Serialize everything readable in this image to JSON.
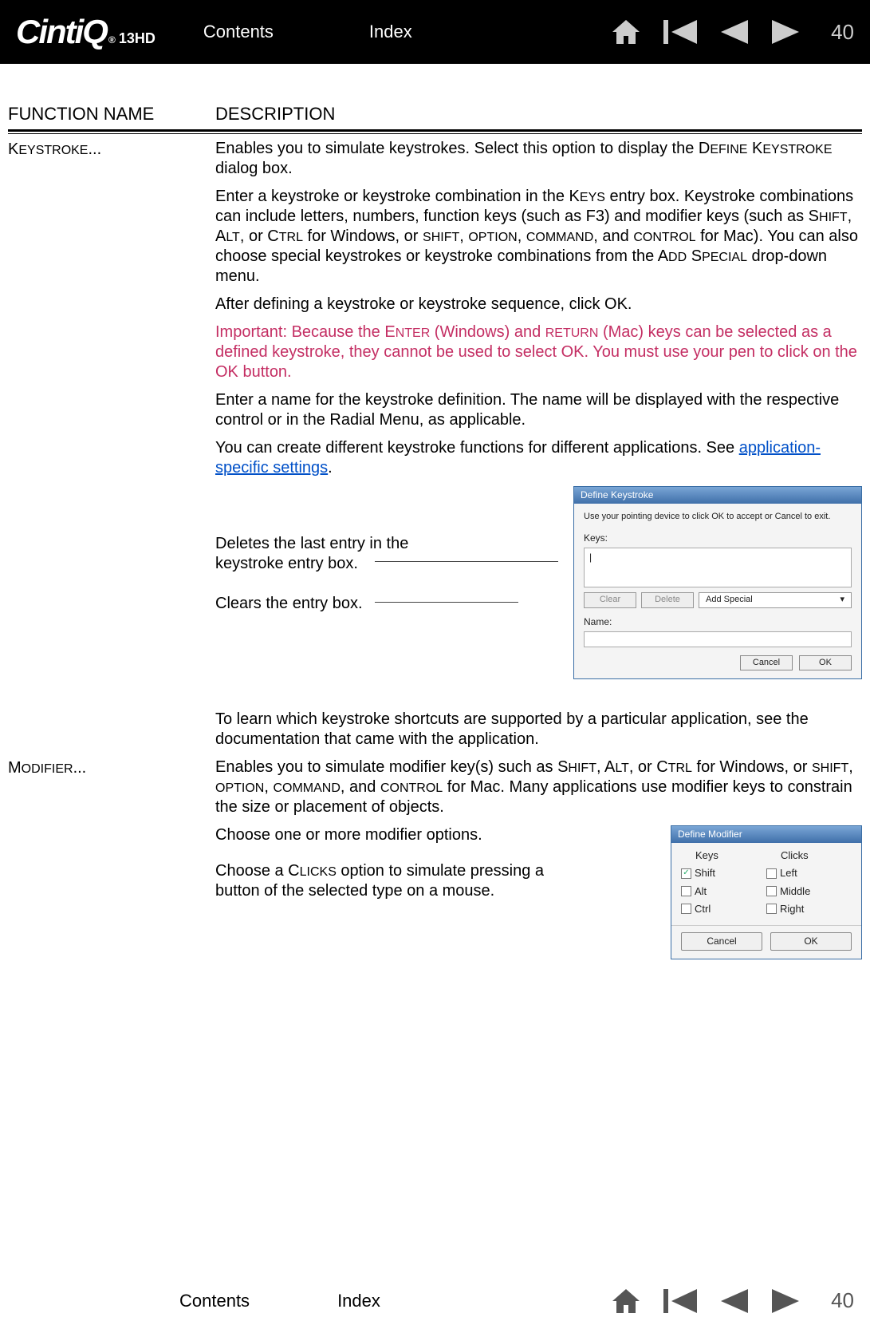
{
  "logo": {
    "main": "CintiQ",
    "sub": "13HD"
  },
  "nav": {
    "contents": "Contents",
    "index": "Index"
  },
  "page_number": "40",
  "table": {
    "headers": {
      "fn": "FUNCTION NAME",
      "desc": "DESCRIPTION"
    },
    "keystroke": {
      "name_pre": "K",
      "name_sc": "EYSTROKE",
      "name_suf": "...",
      "p1_a": "Enables you to simulate keystrokes. Select this option to display the D",
      "p1_b": "EFINE",
      "p1_c": " K",
      "p1_d": "EYSTROKE",
      "p1_e": " dialog box.",
      "p2_a": "Enter a keystroke or keystroke combination in the K",
      "p2_b": "EYS",
      "p2_c": " entry box. Keystroke combinations can include letters, numbers, function keys (such as F3) and modifier keys (such as S",
      "p2_d": "HIFT",
      "p2_e": ", A",
      "p2_f": "LT",
      "p2_g": ", or C",
      "p2_h": "TRL",
      "p2_i": " for Windows, or ",
      "p2_j": "SHIFT",
      "p2_k": ", ",
      "p2_l": "OPTION",
      "p2_m": ", ",
      "p2_n": "COMMAND",
      "p2_o": ", and ",
      "p2_p": "CONTROL",
      "p2_q": " for Mac). You can also choose special keystrokes or keystroke combinations from the A",
      "p2_r": "DD",
      "p2_s": " S",
      "p2_t": "PECIAL",
      "p2_u": " drop-down menu.",
      "p3": "After defining a keystroke or keystroke sequence, click OK.",
      "imp_a": "Important: Because the E",
      "imp_b": "NTER",
      "imp_c": " (Windows) and ",
      "imp_d": "RETURN",
      "imp_e": " (Mac) keys can be selected as a defined keystroke, they cannot be used to select OK. You must use your pen to click on the OK button.",
      "p4": "Enter a name for the keystroke definition. The name will be displayed with the respective control or in the Radial Menu, as applicable.",
      "p5_a": "You can create different keystroke functions for different applications. See ",
      "p5_link": "application-specific settings",
      "p5_b": ".",
      "callout1": "Deletes the last entry in the keystroke entry box.",
      "callout2": "Clears the entry box.",
      "p6": "To learn which keystroke shortcuts are supported by a particular application, see the documentation that came with the application."
    },
    "modifier": {
      "name_pre": "M",
      "name_sc": "ODIFIER",
      "name_suf": "...",
      "p1_a": "Enables you to simulate modifier key(s) such as S",
      "p1_b": "HIFT",
      "p1_c": ", A",
      "p1_d": "LT",
      "p1_e": ", or C",
      "p1_f": "TRL",
      "p1_g": " for Windows, or ",
      "p1_h": "SHIFT",
      "p1_i": ", ",
      "p1_j": "OPTION",
      "p1_k": ", ",
      "p1_l": "COMMAND",
      "p1_m": ", and ",
      "p1_n": "CONTROL",
      "p1_o": " for Mac. Many applications use modifier keys to constrain the size or placement of objects.",
      "c1": "Choose one or more modifier options.",
      "c2_a": "Choose a C",
      "c2_b": "LICKS",
      "c2_c": " option to simulate pressing a button of the selected type on a mouse."
    }
  },
  "dk": {
    "title": "Define Keystroke",
    "hint": "Use your pointing device to click OK to accept or Cancel to exit.",
    "keys_label": "Keys:",
    "keys_value": "|",
    "clear": "Clear",
    "delete": "Delete",
    "add_special": "Add Special",
    "name_label": "Name:",
    "cancel": "Cancel",
    "ok": "OK"
  },
  "dm": {
    "title": "Define Modifier",
    "keys_h": "Keys",
    "clicks_h": "Clicks",
    "shift": "Shift",
    "alt": "Alt",
    "ctrl": "Ctrl",
    "left": "Left",
    "middle": "Middle",
    "right": "Right",
    "cancel": "Cancel",
    "ok": "OK",
    "shift_checked": "✓"
  }
}
